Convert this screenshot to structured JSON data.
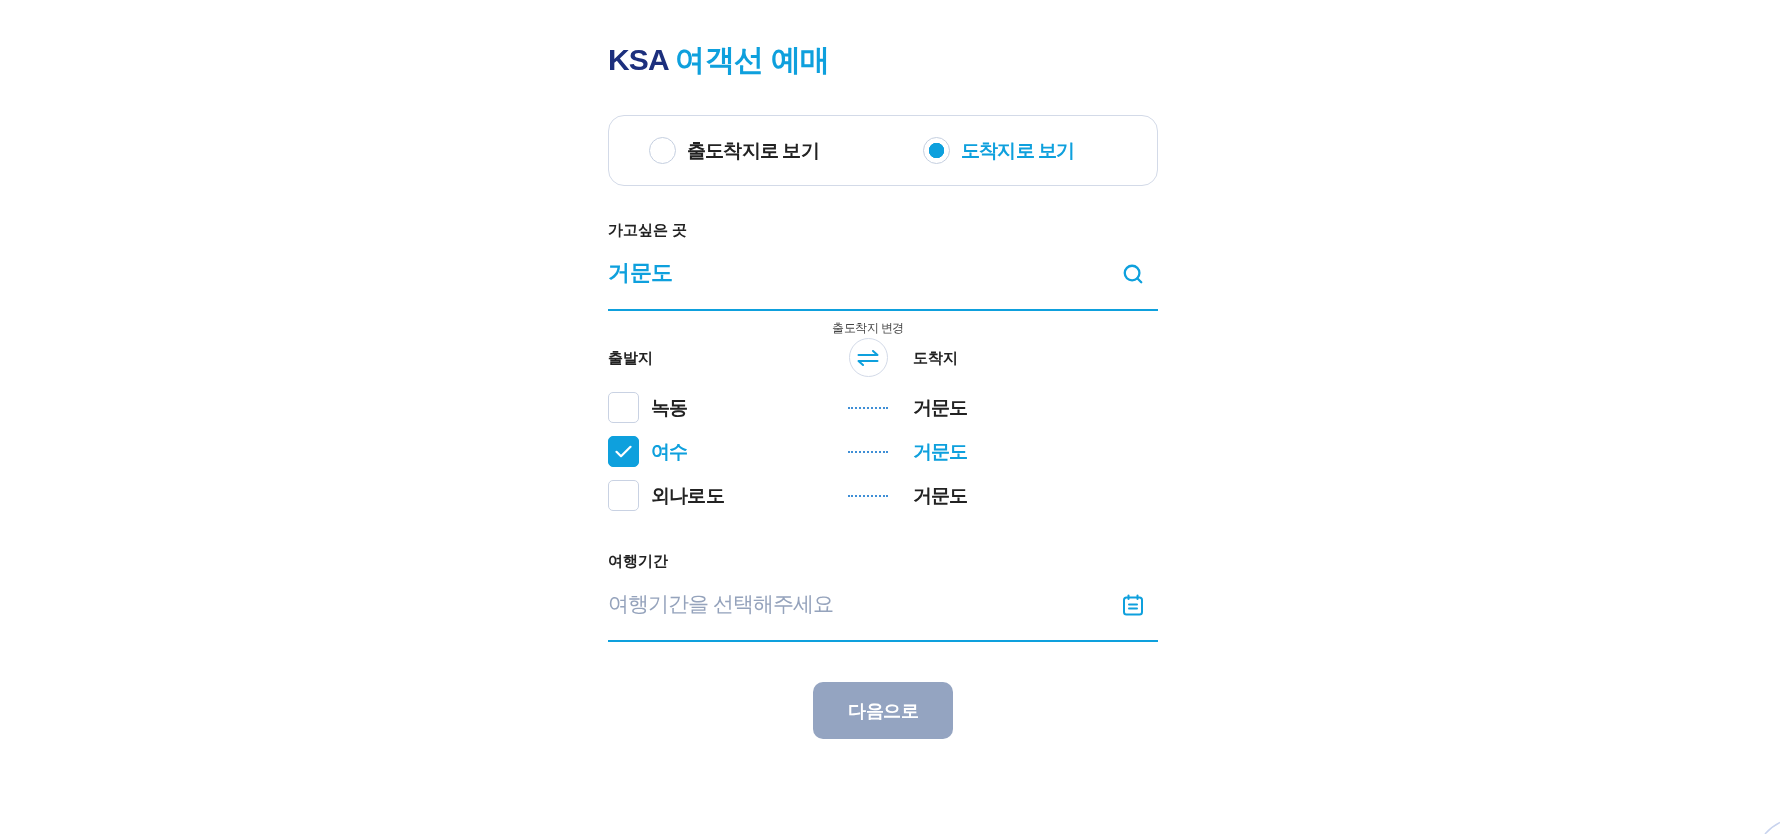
{
  "title": {
    "brand": "KSA",
    "text": "여객선 예매"
  },
  "view_options": [
    {
      "label": "출도착지로 보기",
      "selected": false
    },
    {
      "label": "도착지로 보기",
      "selected": true
    }
  ],
  "destination": {
    "label": "가고싶은 곳",
    "value": "거문도"
  },
  "route_header": {
    "swap_caption": "출도착지 변경",
    "departure_label": "출발지",
    "arrival_label": "도착지"
  },
  "routes": [
    {
      "departure": "녹동",
      "arrival": "거문도",
      "checked": false
    },
    {
      "departure": "여수",
      "arrival": "거문도",
      "checked": true
    },
    {
      "departure": "외나로도",
      "arrival": "거문도",
      "checked": false
    }
  ],
  "travel_period": {
    "label": "여행기간",
    "placeholder": "여행기간을 선택해주세요"
  },
  "next_button": {
    "label": "다음으로",
    "disabled": true
  }
}
